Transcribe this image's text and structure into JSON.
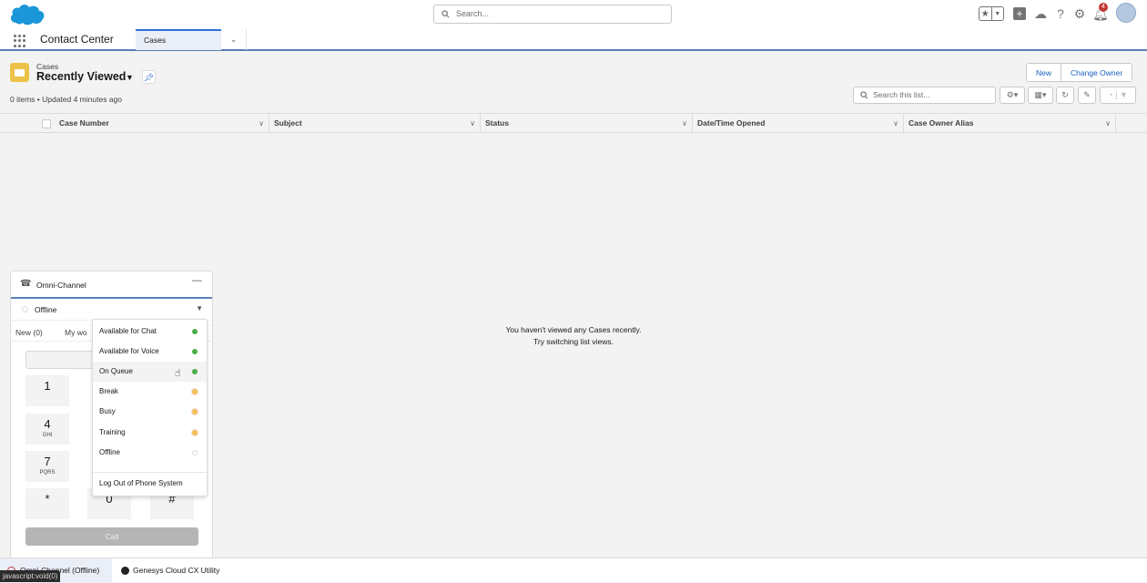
{
  "header": {
    "search_placeholder": "Search...",
    "notification_count": "4",
    "icons": [
      "favorites-star-icon",
      "add-icon",
      "trailhead-icon",
      "help-icon",
      "settings-gear-icon",
      "notifications-bell-icon",
      "user-avatar"
    ]
  },
  "nav": {
    "app_name": "Contact Center",
    "tabs": [
      {
        "label": "Cases",
        "active": true
      }
    ],
    "more_label": "⌄"
  },
  "list_view": {
    "object_label": "Cases",
    "view_name": "Recently Viewed",
    "meta": "0 items • Updated 4 minutes ago",
    "buttons": {
      "new": "New",
      "change_owner": "Change Owner"
    },
    "search_placeholder": "Search this list...",
    "columns": [
      "Case Number",
      "Subject",
      "Status",
      "Date/Time Opened",
      "Case Owner Alias"
    ],
    "empty_line1": "You haven't viewed any Cases recently.",
    "empty_line2": "Try switching list views."
  },
  "omni": {
    "title": "Omni-Channel",
    "status": "Offline",
    "tabs": [
      "New (0)",
      "My wo"
    ],
    "keys": [
      {
        "n": "1",
        "l": ""
      },
      {
        "n": "4",
        "l": "GHI"
      },
      {
        "n": "7",
        "l": "PQRS"
      },
      {
        "n": "*",
        "l": ""
      },
      {
        "n": "0",
        "l": ""
      },
      {
        "n": "#",
        "l": ""
      }
    ],
    "call_label": "Call",
    "menu": [
      {
        "label": "Available for Chat",
        "color": "#4bad48"
      },
      {
        "label": "Available for Voice",
        "color": "#4bad48"
      },
      {
        "label": "On Queue",
        "color": "#4bad48"
      },
      {
        "label": "Break",
        "color": "#f0c25a"
      },
      {
        "label": "Busy",
        "color": "#f0c25a"
      },
      {
        "label": "Training",
        "color": "#f0c25a"
      },
      {
        "label": "Offline",
        "color": "#ffffff"
      }
    ],
    "logout_label": "Log Out of Phone System"
  },
  "utility_bar": {
    "items": [
      "Omni-Channel (Offline)",
      "Genesys Cloud CX Utility"
    ]
  },
  "browser_status": "javascript:void(0)"
}
